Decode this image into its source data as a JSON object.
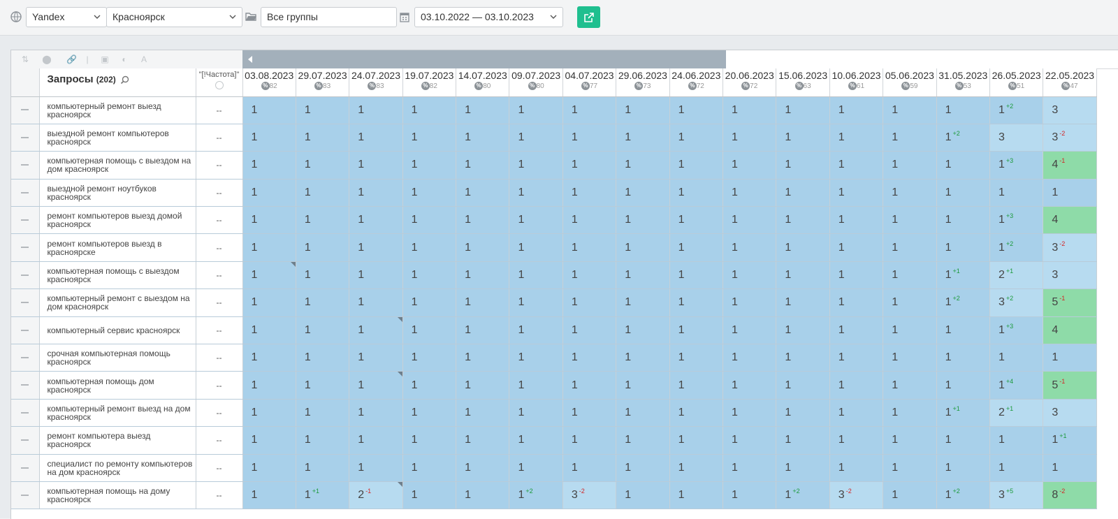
{
  "toolbar": {
    "engine": "Yandex",
    "region": "Красноярск",
    "group": "Все группы",
    "date_range": "03.10.2022 — 03.10.2023"
  },
  "table": {
    "query_header": "Запросы",
    "query_count": "(202)",
    "freq_header": "\"[!Частота]\"",
    "dates": [
      {
        "date": "03.08.2023",
        "pct": "82"
      },
      {
        "date": "29.07.2023",
        "pct": "83"
      },
      {
        "date": "24.07.2023",
        "pct": "83"
      },
      {
        "date": "19.07.2023",
        "pct": "82"
      },
      {
        "date": "14.07.2023",
        "pct": "80"
      },
      {
        "date": "09.07.2023",
        "pct": "80"
      },
      {
        "date": "04.07.2023",
        "pct": "77"
      },
      {
        "date": "29.06.2023",
        "pct": "73"
      },
      {
        "date": "24.06.2023",
        "pct": "72"
      },
      {
        "date": "20.06.2023",
        "pct": "72"
      },
      {
        "date": "15.06.2023",
        "pct": "63"
      },
      {
        "date": "10.06.2023",
        "pct": "61"
      },
      {
        "date": "05.06.2023",
        "pct": "59"
      },
      {
        "date": "31.05.2023",
        "pct": "53"
      },
      {
        "date": "26.05.2023",
        "pct": "51"
      },
      {
        "date": "22.05.2023",
        "pct": "47"
      }
    ],
    "rows": [
      {
        "query": "компьютерный ремонт выезд красноярск",
        "freq": "--",
        "cells": [
          [
            "1"
          ],
          [
            "1"
          ],
          [
            "1"
          ],
          [
            "1"
          ],
          [
            "1"
          ],
          [
            "1"
          ],
          [
            "1"
          ],
          [
            "1"
          ],
          [
            "1"
          ],
          [
            "1"
          ],
          [
            "1"
          ],
          [
            "1"
          ],
          [
            "1"
          ],
          [
            "1"
          ],
          [
            "1",
            "+2"
          ],
          [
            "3"
          ]
        ]
      },
      {
        "query": "выездной ремонт компьютеров красноярск",
        "freq": "--",
        "cells": [
          [
            "1"
          ],
          [
            "1"
          ],
          [
            "1"
          ],
          [
            "1"
          ],
          [
            "1"
          ],
          [
            "1"
          ],
          [
            "1"
          ],
          [
            "1"
          ],
          [
            "1"
          ],
          [
            "1"
          ],
          [
            "1"
          ],
          [
            "1"
          ],
          [
            "1"
          ],
          [
            "1",
            "+2"
          ],
          [
            "3"
          ],
          [
            "3",
            "-2"
          ]
        ]
      },
      {
        "query": "компьютерная помощь с выездом на дом красноярск",
        "freq": "--",
        "cells": [
          [
            "1"
          ],
          [
            "1"
          ],
          [
            "1"
          ],
          [
            "1"
          ],
          [
            "1"
          ],
          [
            "1"
          ],
          [
            "1"
          ],
          [
            "1"
          ],
          [
            "1"
          ],
          [
            "1"
          ],
          [
            "1"
          ],
          [
            "1"
          ],
          [
            "1"
          ],
          [
            "1"
          ],
          [
            "1",
            "+3"
          ],
          [
            "4",
            "-1"
          ]
        ]
      },
      {
        "query": "выездной ремонт ноутбуков красноярск",
        "freq": "--",
        "cells": [
          [
            "1"
          ],
          [
            "1"
          ],
          [
            "1"
          ],
          [
            "1"
          ],
          [
            "1"
          ],
          [
            "1"
          ],
          [
            "1"
          ],
          [
            "1"
          ],
          [
            "1"
          ],
          [
            "1"
          ],
          [
            "1"
          ],
          [
            "1"
          ],
          [
            "1"
          ],
          [
            "1"
          ],
          [
            "1"
          ],
          [
            "1"
          ]
        ]
      },
      {
        "query": "ремонт компьютеров выезд домой красноярск",
        "freq": "--",
        "cells": [
          [
            "1"
          ],
          [
            "1"
          ],
          [
            "1"
          ],
          [
            "1"
          ],
          [
            "1"
          ],
          [
            "1"
          ],
          [
            "1"
          ],
          [
            "1"
          ],
          [
            "1"
          ],
          [
            "1"
          ],
          [
            "1"
          ],
          [
            "1"
          ],
          [
            "1"
          ],
          [
            "1"
          ],
          [
            "1",
            "+3"
          ],
          [
            "4"
          ]
        ]
      },
      {
        "query": "ремонт компьютеров выезд в красноярске",
        "freq": "--",
        "cells": [
          [
            "1"
          ],
          [
            "1"
          ],
          [
            "1"
          ],
          [
            "1"
          ],
          [
            "1"
          ],
          [
            "1"
          ],
          [
            "1"
          ],
          [
            "1"
          ],
          [
            "1"
          ],
          [
            "1"
          ],
          [
            "1"
          ],
          [
            "1"
          ],
          [
            "1"
          ],
          [
            "1"
          ],
          [
            "1",
            "+2"
          ],
          [
            "3",
            "-2"
          ]
        ]
      },
      {
        "query": "компьютерная помощь с выездом красноярск",
        "freq": "--",
        "cells": [
          [
            "1"
          ],
          [
            "1"
          ],
          [
            "1"
          ],
          [
            "1"
          ],
          [
            "1"
          ],
          [
            "1"
          ],
          [
            "1"
          ],
          [
            "1"
          ],
          [
            "1"
          ],
          [
            "1"
          ],
          [
            "1"
          ],
          [
            "1"
          ],
          [
            "1"
          ],
          [
            "1",
            "+1"
          ],
          [
            "2",
            "+1"
          ],
          [
            "3"
          ]
        ]
      },
      {
        "query": "компьютерный ремонт с выездом на дом красноярск",
        "freq": "--",
        "cells": [
          [
            "1"
          ],
          [
            "1"
          ],
          [
            "1"
          ],
          [
            "1"
          ],
          [
            "1"
          ],
          [
            "1"
          ],
          [
            "1"
          ],
          [
            "1"
          ],
          [
            "1"
          ],
          [
            "1"
          ],
          [
            "1"
          ],
          [
            "1"
          ],
          [
            "1"
          ],
          [
            "1",
            "+2"
          ],
          [
            "3",
            "+2"
          ],
          [
            "5",
            "-1"
          ]
        ]
      },
      {
        "query": "компьютерный сервис красноярск",
        "freq": "--",
        "cells": [
          [
            "1"
          ],
          [
            "1"
          ],
          [
            "1"
          ],
          [
            "1"
          ],
          [
            "1"
          ],
          [
            "1"
          ],
          [
            "1"
          ],
          [
            "1"
          ],
          [
            "1"
          ],
          [
            "1"
          ],
          [
            "1"
          ],
          [
            "1"
          ],
          [
            "1"
          ],
          [
            "1"
          ],
          [
            "1",
            "+3"
          ],
          [
            "4"
          ]
        ]
      },
      {
        "query": "срочная компьютерная помощь красноярск",
        "freq": "--",
        "cells": [
          [
            "1"
          ],
          [
            "1"
          ],
          [
            "1"
          ],
          [
            "1"
          ],
          [
            "1"
          ],
          [
            "1"
          ],
          [
            "1"
          ],
          [
            "1"
          ],
          [
            "1"
          ],
          [
            "1"
          ],
          [
            "1"
          ],
          [
            "1"
          ],
          [
            "1"
          ],
          [
            "1"
          ],
          [
            "1"
          ],
          [
            "1"
          ]
        ]
      },
      {
        "query": "компьютерная помощь дом красноярск",
        "freq": "--",
        "cells": [
          [
            "1"
          ],
          [
            "1"
          ],
          [
            "1"
          ],
          [
            "1"
          ],
          [
            "1"
          ],
          [
            "1"
          ],
          [
            "1"
          ],
          [
            "1"
          ],
          [
            "1"
          ],
          [
            "1"
          ],
          [
            "1"
          ],
          [
            "1"
          ],
          [
            "1"
          ],
          [
            "1"
          ],
          [
            "1",
            "+4"
          ],
          [
            "5",
            "-1"
          ]
        ]
      },
      {
        "query": "компьютерный ремонт выезд на дом красноярск",
        "freq": "--",
        "cells": [
          [
            "1"
          ],
          [
            "1"
          ],
          [
            "1"
          ],
          [
            "1"
          ],
          [
            "1"
          ],
          [
            "1"
          ],
          [
            "1"
          ],
          [
            "1"
          ],
          [
            "1"
          ],
          [
            "1"
          ],
          [
            "1"
          ],
          [
            "1"
          ],
          [
            "1"
          ],
          [
            "1",
            "+1"
          ],
          [
            "2",
            "+1"
          ],
          [
            "3"
          ]
        ]
      },
      {
        "query": "ремонт компьютера выезд красноярск",
        "freq": "--",
        "cells": [
          [
            "1"
          ],
          [
            "1"
          ],
          [
            "1"
          ],
          [
            "1"
          ],
          [
            "1"
          ],
          [
            "1"
          ],
          [
            "1"
          ],
          [
            "1"
          ],
          [
            "1"
          ],
          [
            "1"
          ],
          [
            "1"
          ],
          [
            "1"
          ],
          [
            "1"
          ],
          [
            "1"
          ],
          [
            "1"
          ],
          [
            "1",
            "+1"
          ]
        ]
      },
      {
        "query": "специалист по ремонту компьютеров на дом красноярск",
        "freq": "--",
        "cells": [
          [
            "1"
          ],
          [
            "1"
          ],
          [
            "1"
          ],
          [
            "1"
          ],
          [
            "1"
          ],
          [
            "1"
          ],
          [
            "1"
          ],
          [
            "1"
          ],
          [
            "1"
          ],
          [
            "1"
          ],
          [
            "1"
          ],
          [
            "1"
          ],
          [
            "1"
          ],
          [
            "1"
          ],
          [
            "1"
          ],
          [
            "1"
          ]
        ]
      },
      {
        "query": "компьютерная помощь на дому красноярск",
        "freq": "--",
        "cells": [
          [
            "1"
          ],
          [
            "1",
            "+1"
          ],
          [
            "2",
            "-1"
          ],
          [
            "1"
          ],
          [
            "1"
          ],
          [
            "1",
            "+2"
          ],
          [
            "3",
            "-2"
          ],
          [
            "1"
          ],
          [
            "1"
          ],
          [
            "1"
          ],
          [
            "1",
            "+2"
          ],
          [
            "3",
            "-2"
          ],
          [
            "1"
          ],
          [
            "1",
            "+2"
          ],
          [
            "3",
            "+5"
          ],
          [
            "8",
            "-2"
          ]
        ]
      }
    ]
  }
}
